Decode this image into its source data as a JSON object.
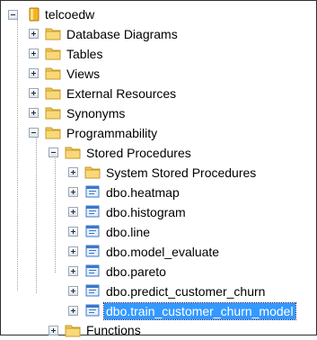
{
  "tree": {
    "root": {
      "label": "telcoedw",
      "expanded": true
    },
    "nodes": {
      "database_diagrams": {
        "label": "Database Diagrams",
        "expanded": false
      },
      "tables": {
        "label": "Tables",
        "expanded": false
      },
      "views": {
        "label": "Views",
        "expanded": false
      },
      "external_resources": {
        "label": "External Resources",
        "expanded": false
      },
      "synonyms": {
        "label": "Synonyms",
        "expanded": false
      },
      "programmability": {
        "label": "Programmability",
        "expanded": true
      },
      "stored_procedures": {
        "label": "Stored Procedures",
        "expanded": true
      },
      "system_stored_procedures": {
        "label": "System Stored Procedures",
        "expanded": false
      },
      "functions": {
        "label": "Functions",
        "expanded": false
      }
    },
    "procedures": [
      {
        "label": "dbo.heatmap",
        "selected": false
      },
      {
        "label": "dbo.histogram",
        "selected": false
      },
      {
        "label": "dbo.line",
        "selected": false
      },
      {
        "label": "dbo.model_evaluate",
        "selected": false
      },
      {
        "label": "dbo.pareto",
        "selected": false
      },
      {
        "label": "dbo.predict_customer_churn",
        "selected": false
      },
      {
        "label": "dbo.train_customer_churn_model",
        "selected": true
      }
    ]
  },
  "icons": {
    "database": "database-icon",
    "folder": "folder-icon",
    "procedure": "stored-procedure-icon"
  },
  "colors": {
    "selection": "#3399ff",
    "folder": "#f0c85a",
    "database": "#f2b522",
    "procedure": "#3c78c8"
  }
}
